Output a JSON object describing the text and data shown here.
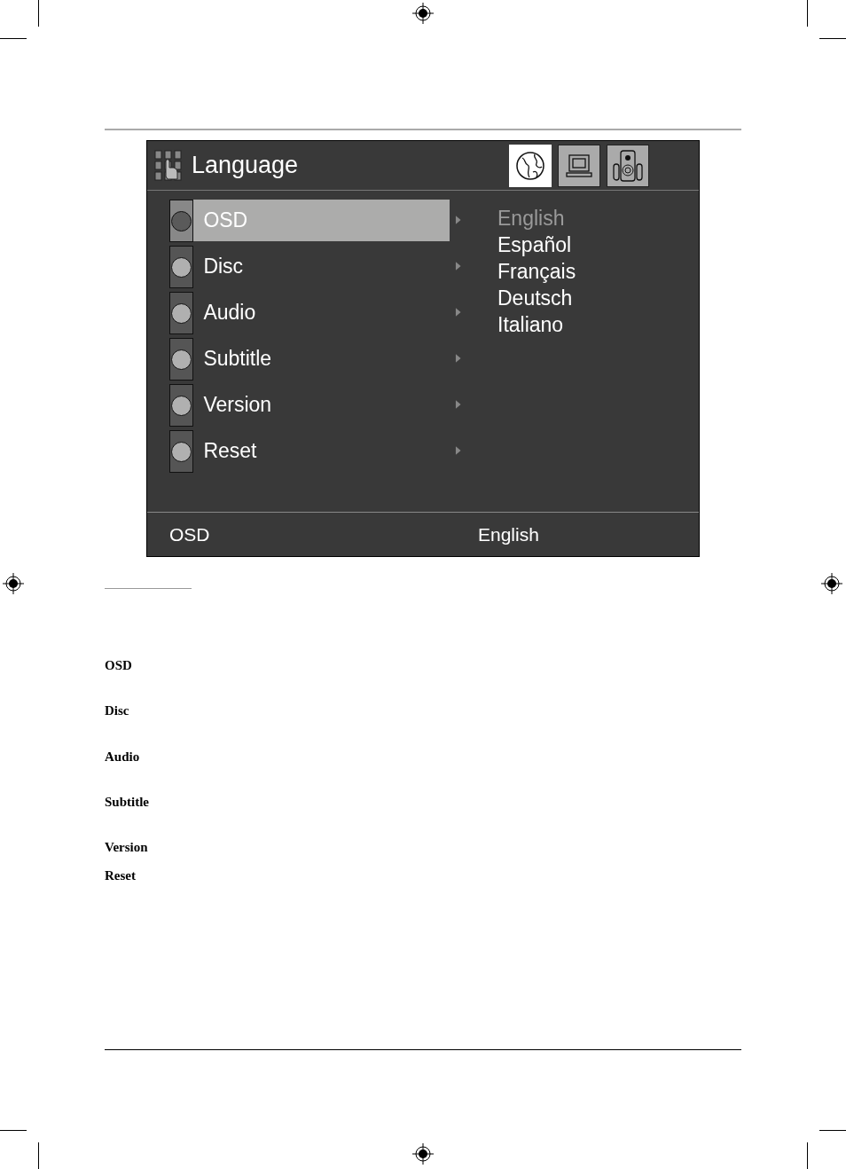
{
  "osd": {
    "title": "Language",
    "tabs": [
      {
        "kind": "globe",
        "selected": true
      },
      {
        "kind": "monitor",
        "selected": false
      },
      {
        "kind": "speaker",
        "selected": false
      }
    ],
    "menu": [
      {
        "label": "OSD",
        "selected": true
      },
      {
        "label": "Disc",
        "selected": false
      },
      {
        "label": "Audio",
        "selected": false
      },
      {
        "label": "Subtitle",
        "selected": false
      },
      {
        "label": "Version",
        "selected": false
      },
      {
        "label": "Reset",
        "selected": false
      }
    ],
    "options": [
      {
        "label": "English",
        "selected": true
      },
      {
        "label": "Español",
        "selected": false
      },
      {
        "label": "Français",
        "selected": false
      },
      {
        "label": "Deutsch",
        "selected": false
      },
      {
        "label": "Italiano",
        "selected": false
      }
    ],
    "status_bar": {
      "item": "OSD",
      "value": "English"
    }
  },
  "terms": [
    "OSD",
    "Disc",
    "Audio",
    "Subtitle",
    "Version",
    "Reset"
  ]
}
